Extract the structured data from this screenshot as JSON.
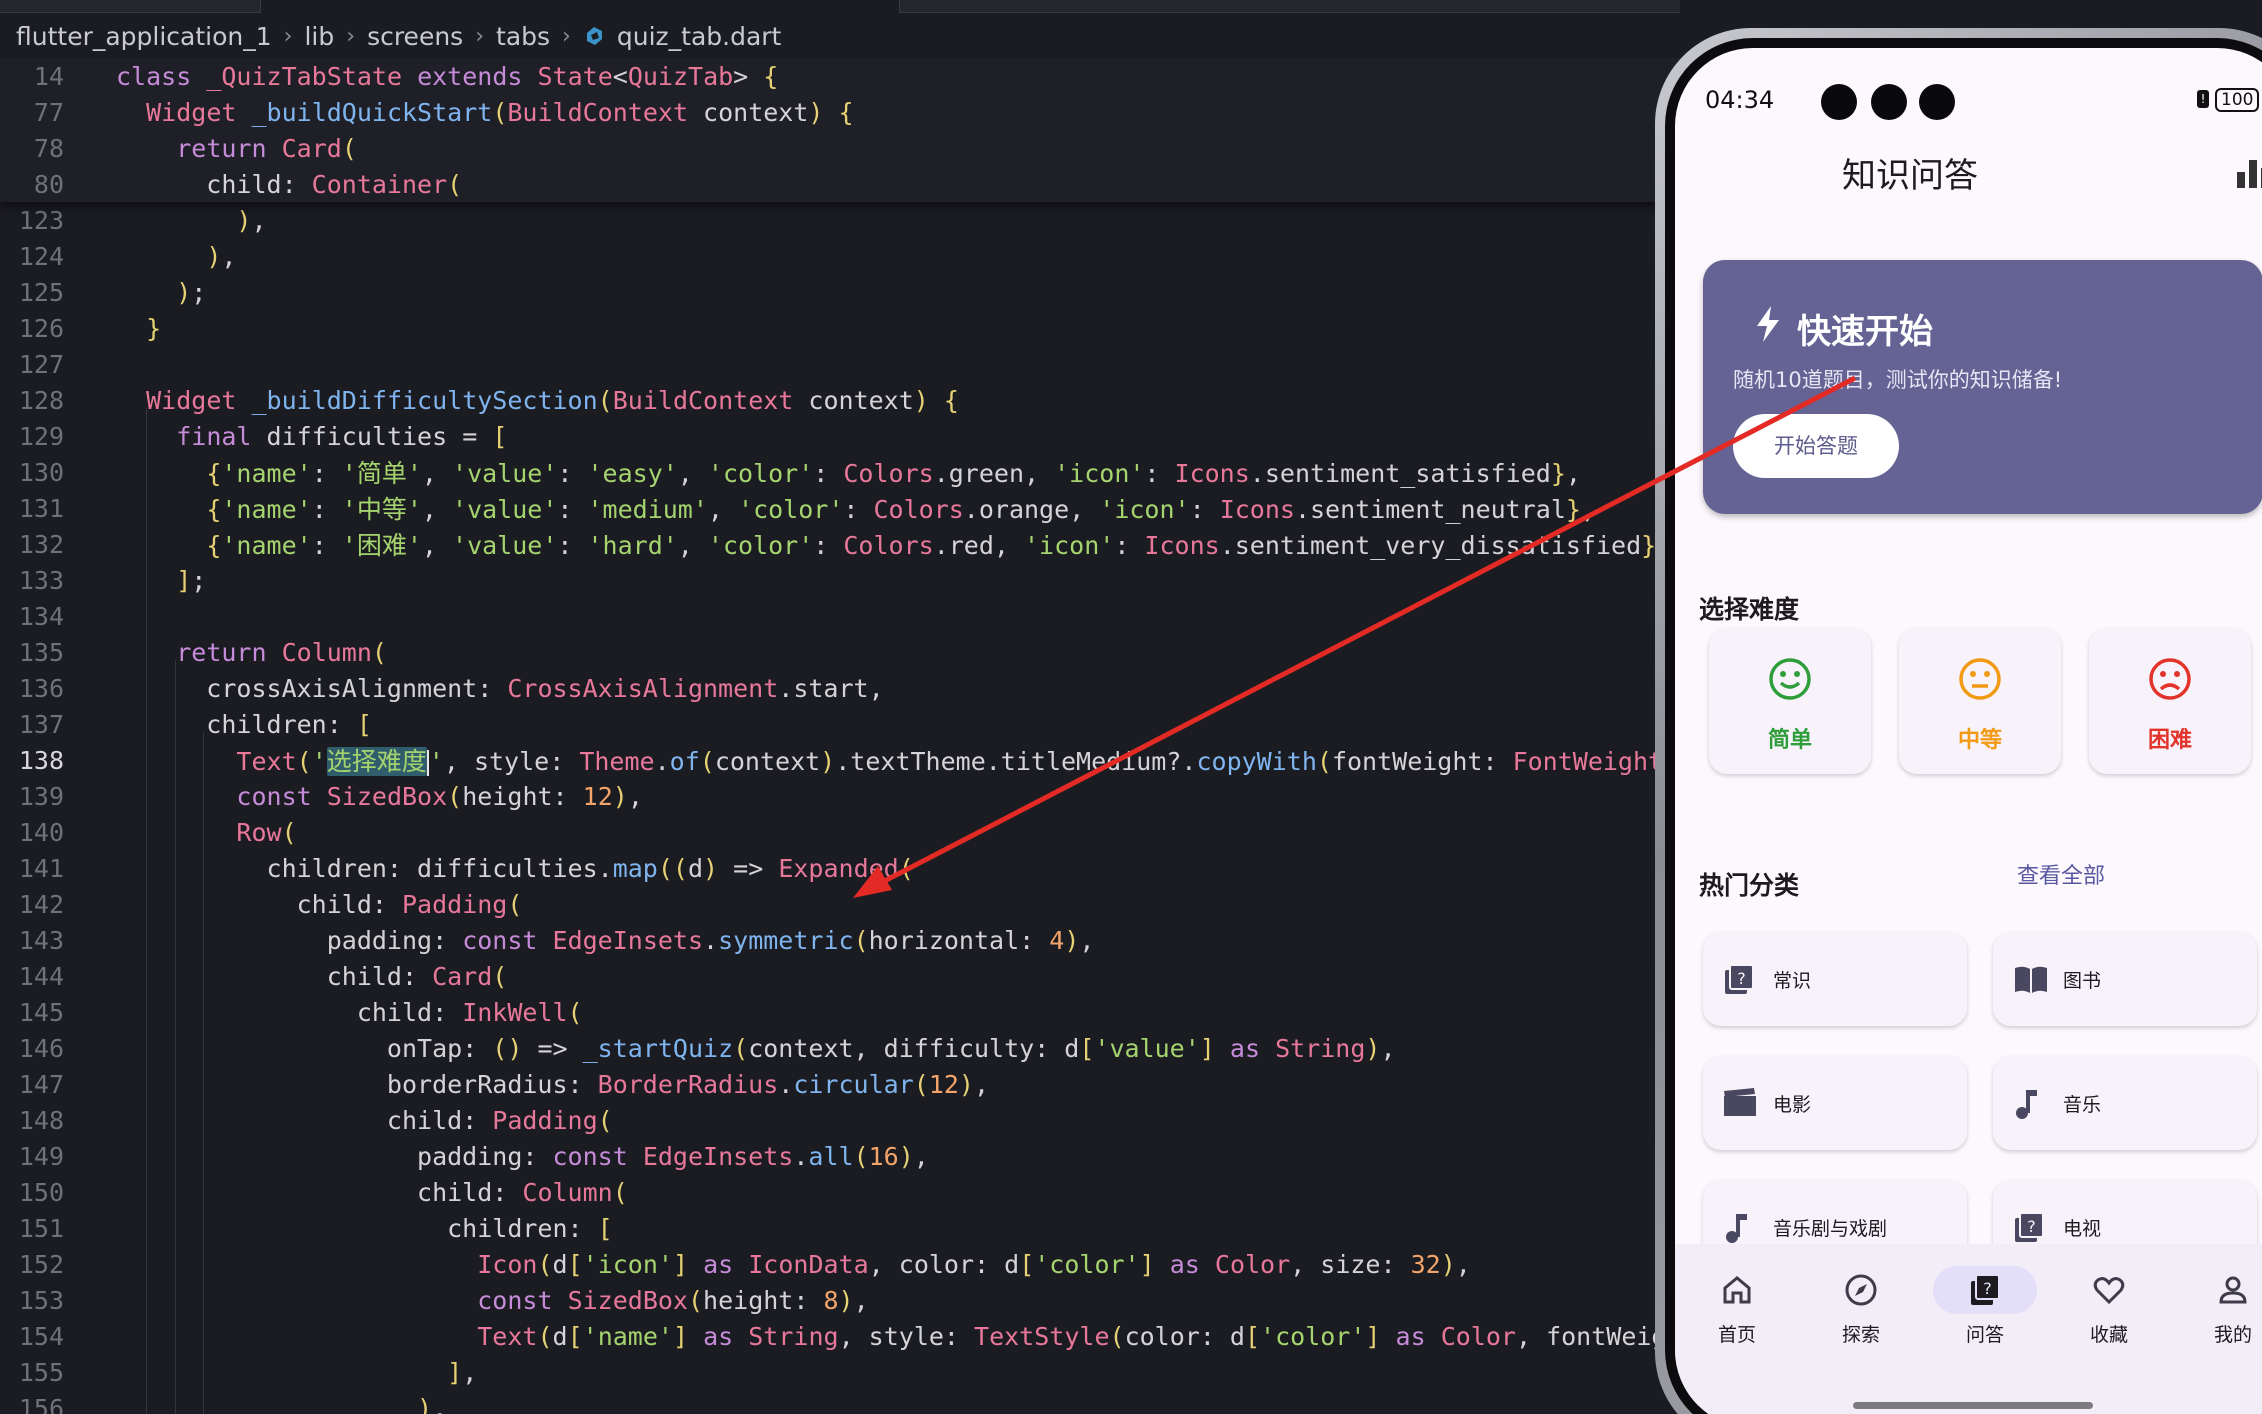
{
  "editor": {
    "breadcrumb": [
      "flutter_application_1",
      "lib",
      "screens",
      "tabs",
      "quiz_tab.dart"
    ],
    "sticky_lines": [
      {
        "num": "14",
        "code": "class _QuizTabState extends State<QuizTab> {"
      },
      {
        "num": "77",
        "code": "  Widget _buildQuickStart(BuildContext context) {"
      },
      {
        "num": "78",
        "code": "    return Card("
      },
      {
        "num": "80",
        "code": "      child: Container("
      }
    ],
    "lines": [
      {
        "num": "123",
        "code": "        ),"
      },
      {
        "num": "124",
        "code": "      ),"
      },
      {
        "num": "125",
        "code": "    );"
      },
      {
        "num": "126",
        "code": "  }"
      },
      {
        "num": "127",
        "code": ""
      },
      {
        "num": "128",
        "code": "  Widget _buildDifficultySection(BuildContext context) {"
      },
      {
        "num": "129",
        "code": "    final difficulties = ["
      },
      {
        "num": "130",
        "code": "      {'name': '简单', 'value': 'easy', 'color': Colors.green, 'icon': Icons.sentiment_satisfied},"
      },
      {
        "num": "131",
        "code": "      {'name': '中等', 'value': 'medium', 'color': Colors.orange, 'icon': Icons.sentiment_neutral},"
      },
      {
        "num": "132",
        "code": "      {'name': '困难', 'value': 'hard', 'color': Colors.red, 'icon': Icons.sentiment_very_dissatisfied},"
      },
      {
        "num": "133",
        "code": "    ];"
      },
      {
        "num": "134",
        "code": ""
      },
      {
        "num": "135",
        "code": "    return Column("
      },
      {
        "num": "136",
        "code": "      crossAxisAlignment: CrossAxisAlignment.start,"
      },
      {
        "num": "137",
        "code": "      children: ["
      },
      {
        "num": "138",
        "code": "        Text('选择难度', style: Theme.of(context).textTheme.titleMedium?.copyWith(fontWeight: FontWeight.bol"
      },
      {
        "num": "139",
        "code": "        const SizedBox(height: 12),"
      },
      {
        "num": "140",
        "code": "        Row("
      },
      {
        "num": "141",
        "code": "          children: difficulties.map((d) => Expanded("
      },
      {
        "num": "142",
        "code": "            child: Padding("
      },
      {
        "num": "143",
        "code": "              padding: const EdgeInsets.symmetric(horizontal: 4),"
      },
      {
        "num": "144",
        "code": "              child: Card("
      },
      {
        "num": "145",
        "code": "                child: InkWell("
      },
      {
        "num": "146",
        "code": "                  onTap: () => _startQuiz(context, difficulty: d['value'] as String),"
      },
      {
        "num": "147",
        "code": "                  borderRadius: BorderRadius.circular(12),"
      },
      {
        "num": "148",
        "code": "                  child: Padding("
      },
      {
        "num": "149",
        "code": "                    padding: const EdgeInsets.all(16),"
      },
      {
        "num": "150",
        "code": "                    child: Column("
      },
      {
        "num": "151",
        "code": "                      children: ["
      },
      {
        "num": "152",
        "code": "                        Icon(d['icon'] as IconData, color: d['color'] as Color, size: 32),"
      },
      {
        "num": "153",
        "code": "                        const SizedBox(height: 8),"
      },
      {
        "num": "154",
        "code": "                        Text(d['name'] as String, style: TextStyle(color: d['color'] as Color, fontWeight:"
      },
      {
        "num": "155",
        "code": "                      ],"
      },
      {
        "num": "156",
        "code": "                    ),"
      }
    ],
    "current_line": "138"
  },
  "phone": {
    "status_time": "04:34",
    "battery": "100",
    "app_title": "知识问答",
    "quick_start": {
      "title": "快速开始",
      "subtitle": "随机10道题目，测试你的知识储备!",
      "button": "开始答题"
    },
    "difficulty": {
      "title": "选择难度",
      "items": [
        {
          "label": "简单",
          "color": "#2e9e3a"
        },
        {
          "label": "中等",
          "color": "#f29a14"
        },
        {
          "label": "困难",
          "color": "#e2342b"
        }
      ]
    },
    "categories": {
      "title": "热门分类",
      "see_all": "查看全部",
      "items": [
        {
          "label": "常识",
          "icon": "quiz-icon"
        },
        {
          "label": "图书",
          "icon": "book-icon"
        },
        {
          "label": "电影",
          "icon": "movie-icon"
        },
        {
          "label": "音乐",
          "icon": "music-note-icon"
        },
        {
          "label": "音乐剧与戏剧",
          "icon": "music-note-icon"
        },
        {
          "label": "电视",
          "icon": "quiz-icon"
        }
      ]
    },
    "nav": [
      {
        "label": "首页",
        "icon": "home-icon"
      },
      {
        "label": "探索",
        "icon": "compass-icon"
      },
      {
        "label": "问答",
        "icon": "quiz-icon",
        "active": true
      },
      {
        "label": "收藏",
        "icon": "heart-icon"
      },
      {
        "label": "我的",
        "icon": "person-icon"
      }
    ]
  },
  "colors": {
    "editor_bg": "#1b1c22",
    "quick_card": "#646394",
    "annotation_arrow": "#e32a25"
  }
}
